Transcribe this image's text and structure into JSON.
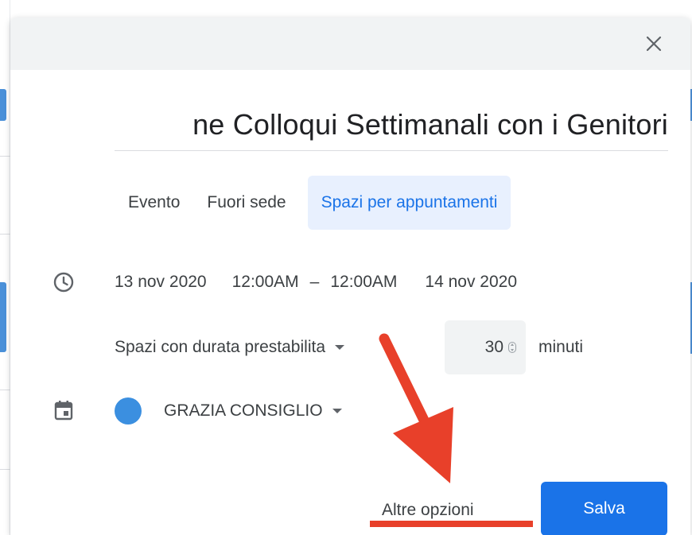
{
  "dialog": {
    "close_icon": "close-icon",
    "title": "ne Colloqui Settimanali con i Genitori",
    "tabs": [
      {
        "label": "Evento",
        "active": false
      },
      {
        "label": "Fuori sede",
        "active": false
      },
      {
        "label": "Spazi per appuntamenti",
        "active": true
      }
    ],
    "datetime": {
      "icon": "clock-icon",
      "start_date": "13 nov 2020",
      "start_time": "12:00AM",
      "separator": "–",
      "end_time": "12:00AM",
      "end_date": "14 nov 2020"
    },
    "slots": {
      "mode_label": "Spazi con durata prestabilita",
      "duration_value": "30",
      "unit_label": "minuti"
    },
    "calendar": {
      "icon": "calendar-icon",
      "name": "GRAZIA CONSIGLIO",
      "color": "#3b8fe0"
    },
    "actions": {
      "more_label": "Altre opzioni",
      "save_label": "Salva"
    }
  },
  "colors": {
    "accent": "#1a73e8",
    "save_button": "#1a73e8",
    "annotation_red": "#e8402a"
  }
}
